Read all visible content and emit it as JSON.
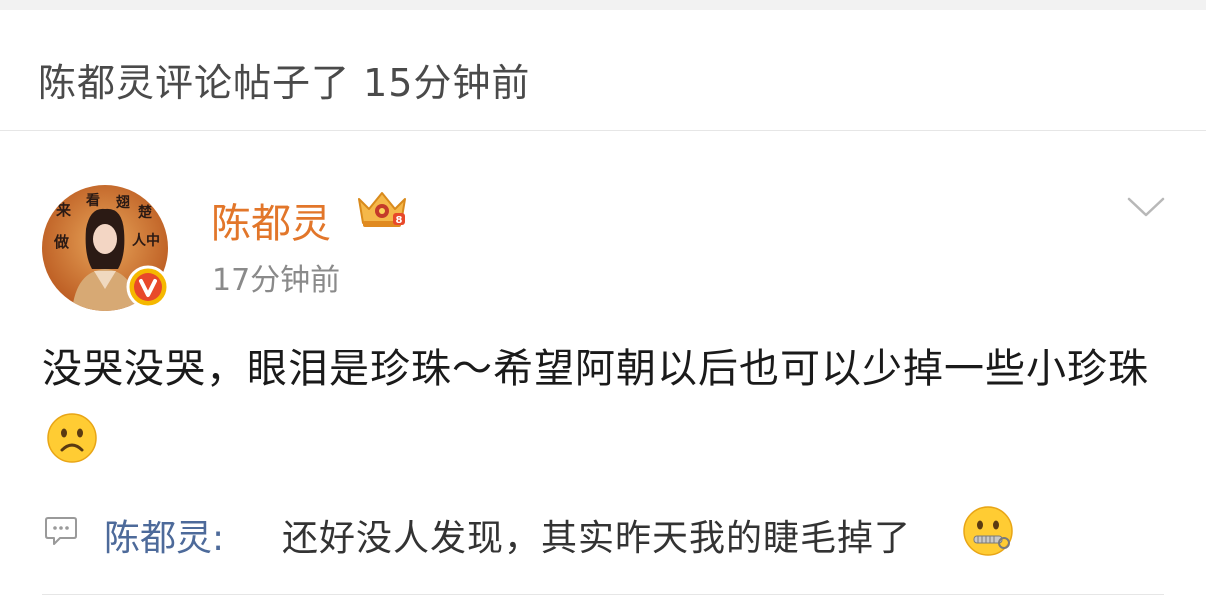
{
  "activity": {
    "text": "陈都灵评论帖子了 15分钟前"
  },
  "post": {
    "author": "陈都灵",
    "time": "17分钟前",
    "content": "没哭没哭，眼泪是珍珠～希望阿朝以后也可以少掉一些小珍珠",
    "content_emoji": "frowning-face-emoji",
    "avatar_text": [
      "来",
      "看",
      "翅",
      "楚",
      "做",
      "人",
      "中"
    ],
    "badge_icon": "verified-v-icon",
    "crown_icon": "crown-membership-icon"
  },
  "comment": {
    "author": "陈都灵:",
    "text": "还好没人发现，其实昨天我的睫毛掉了",
    "emoji": "zipper-mouth-face-emoji"
  },
  "colors": {
    "author_orange": "#e2762a",
    "comment_author_blue": "#4d6a9a",
    "badge_yellow": "#f5b800",
    "badge_red": "#e8492a"
  }
}
